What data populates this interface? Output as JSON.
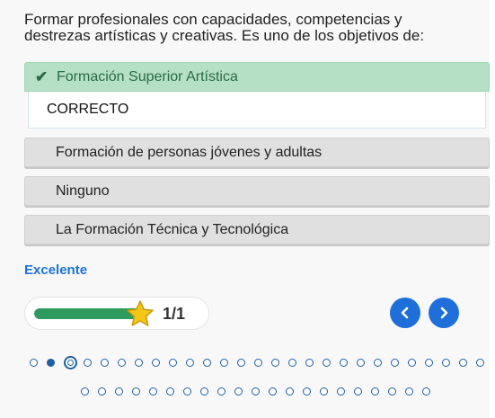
{
  "question": {
    "line1": "Formar profesionales con capacidades, competencias y",
    "line2": "destrezas artísticas y creativas. Es uno de los objetivos de:"
  },
  "answers": [
    {
      "label": "Formación Superior Artística",
      "state": "correct"
    },
    {
      "label": "Formación de personas jóvenes y adultas",
      "state": "unselected"
    },
    {
      "label": "Ninguno",
      "state": "unselected"
    },
    {
      "label": "La Formación Técnica y Tecnológica",
      "state": "unselected"
    }
  ],
  "feedback": "CORRECTO",
  "result": "Excelente",
  "progress": {
    "score": "1/1",
    "fraction": 1.0
  },
  "nav": {
    "prev_icon": "chevron-left-icon",
    "next_icon": "chevron-right-icon"
  },
  "pagination": {
    "row1_count": 27,
    "row2_count": 21,
    "current_index": 2,
    "answered": [
      1
    ]
  },
  "colors": {
    "accent": "#1e6fd9",
    "correct_bg": "#b5e0c5",
    "correct_text": "#2b6b45",
    "progress_fill": "#2f9a5d",
    "star": "#f5c518"
  }
}
